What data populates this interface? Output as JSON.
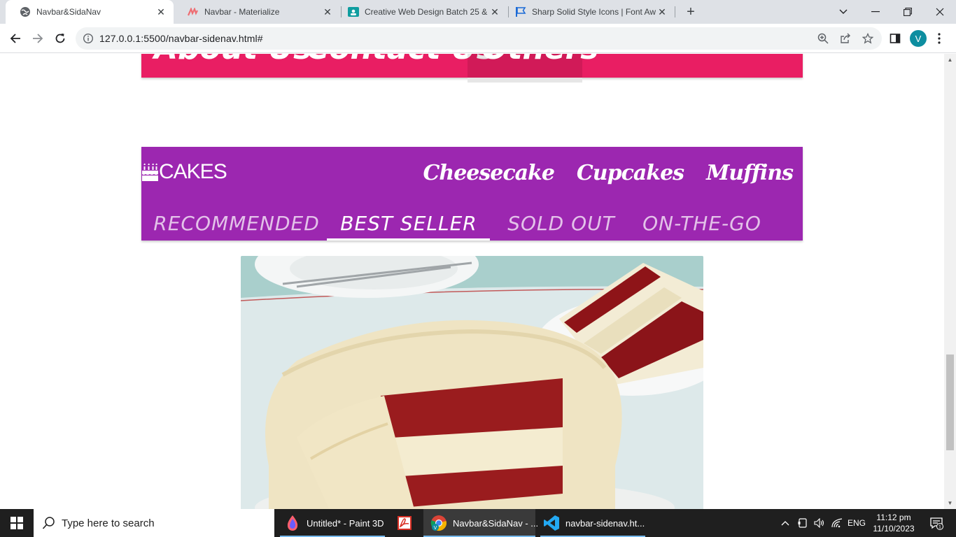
{
  "browser": {
    "tabs": [
      {
        "title": "Navbar&SidaNav",
        "active": true
      },
      {
        "title": "Navbar - Materialize",
        "active": false
      },
      {
        "title": "Creative Web Design Batch 25 &",
        "active": false
      },
      {
        "title": "Sharp Solid Style Icons | Font Aw",
        "active": false
      }
    ],
    "url": "127.0.0.1:5500/navbar-sidenav.html#",
    "profile_initial": "V"
  },
  "page": {
    "pink_nav": {
      "items": [
        "About Us",
        "Contact Us",
        "Others"
      ],
      "active_index": 2,
      "color": "#e91e63"
    },
    "cakes_nav": {
      "brand": "CAKES",
      "brand_icon": "birthday-cake-icon",
      "menu": [
        "Cheesecake",
        "Cupcakes",
        "Muffins"
      ],
      "tabs": [
        "RECOMMENDED",
        "BEST SELLER",
        "SOLD OUT",
        "ON-THE-GO"
      ],
      "active_tab": 1,
      "color": "#9c27b0"
    }
  },
  "taskbar": {
    "search_placeholder": "Type here to search",
    "apps": [
      {
        "label": "Untitled* - Paint 3D",
        "icon": "paint3d-icon"
      },
      {
        "label": "",
        "icon": "acrobat-icon"
      },
      {
        "label": "Navbar&SidaNav - ...",
        "icon": "chrome-icon"
      },
      {
        "label": "navbar-sidenav.ht...",
        "icon": "vscode-icon"
      }
    ],
    "language": "ENG",
    "time": "11:12 pm",
    "date": "11/10/2023",
    "notification_count": "1"
  }
}
